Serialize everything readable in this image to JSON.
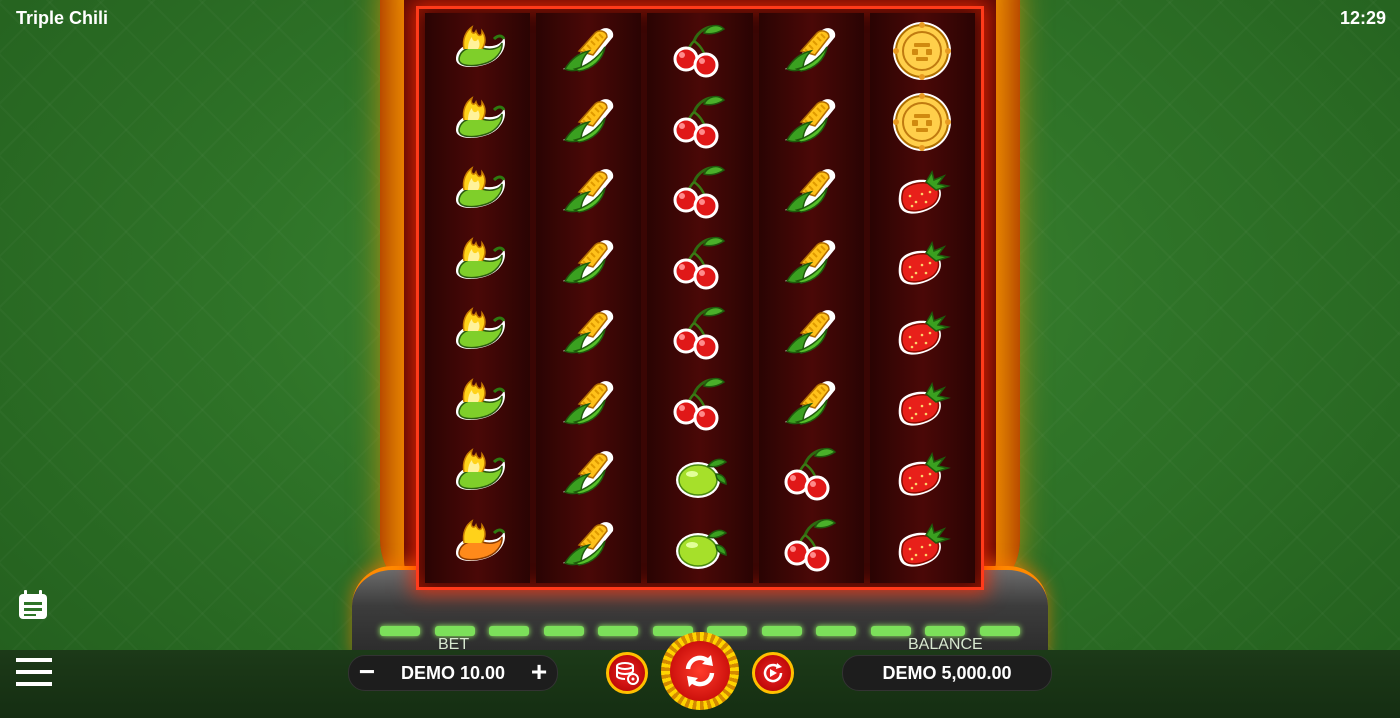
{
  "app": {
    "title": "Triple Chili",
    "clock": "12:29"
  },
  "reels": [
    [
      "chili-green",
      "chili-green",
      "chili-green",
      "chili-green",
      "chili-green",
      "chili-green",
      "chili-green",
      "chili-orange"
    ],
    [
      "corn",
      "corn",
      "corn",
      "corn",
      "corn",
      "corn",
      "corn",
      "corn"
    ],
    [
      "cherry",
      "cherry",
      "cherry",
      "cherry",
      "cherry",
      "cherry",
      "lime",
      "lime"
    ],
    [
      "corn",
      "corn",
      "corn",
      "corn",
      "corn",
      "corn",
      "cherry",
      "cherry"
    ],
    [
      "gold-coin",
      "gold-coin",
      "strawberry",
      "strawberry",
      "strawberry",
      "strawberry",
      "strawberry",
      "strawberry"
    ]
  ],
  "controls": {
    "bet_label": "BET",
    "bet_value": "DEMO 10.00",
    "minus": "−",
    "plus": "+",
    "balance_label": "BALANCE",
    "balance_value": "DEMO 5,000.00"
  },
  "icons": {
    "history": "calendar-icon",
    "menu": "hamburger-menu-icon",
    "bet_settings": "coins-settings-icon",
    "spin": "spin-arrows-icon",
    "autoplay": "autoplay-icon"
  },
  "colors": {
    "accent": "#ffc000",
    "button_red": "#d01010",
    "reel_border": "#ff3a1a"
  }
}
